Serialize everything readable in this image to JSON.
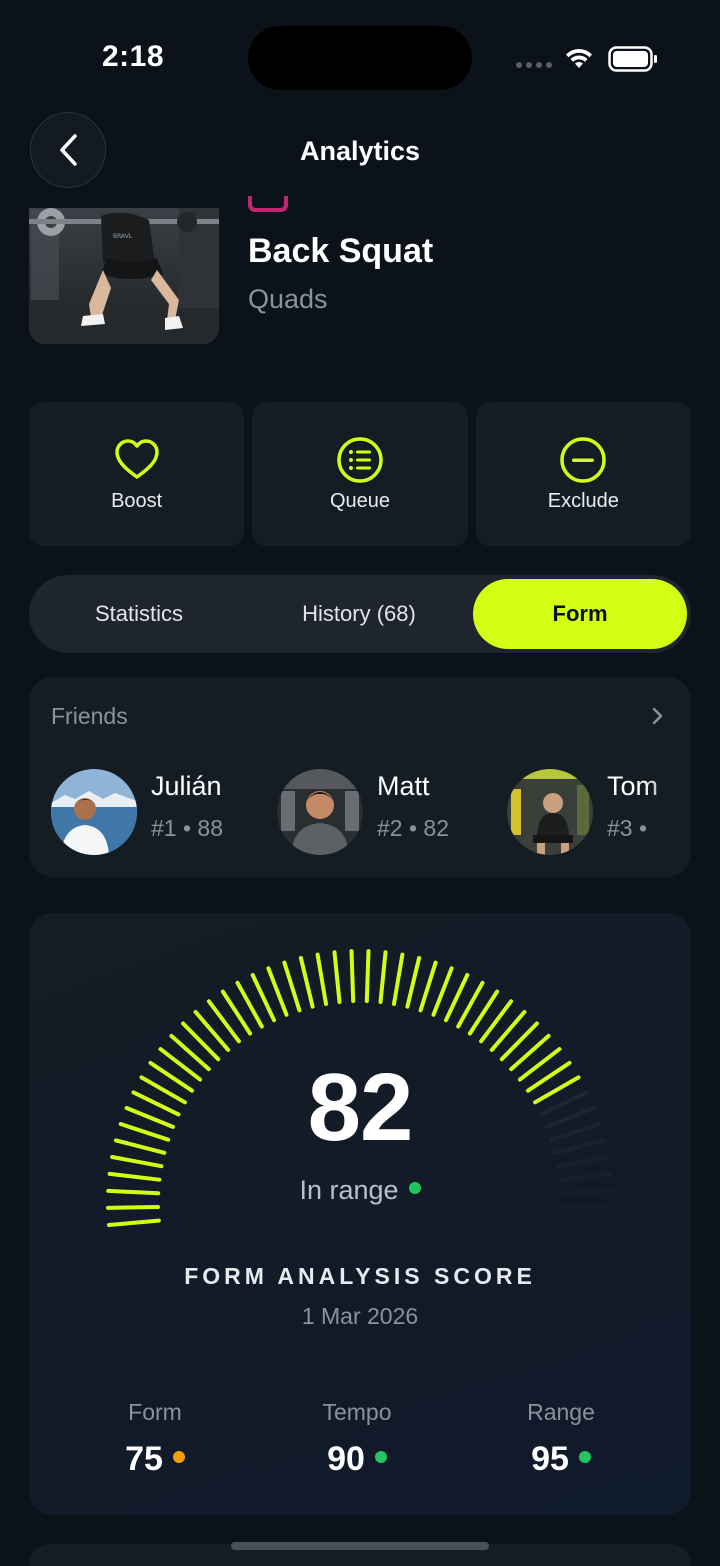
{
  "status_bar": {
    "time": "2:18"
  },
  "nav": {
    "title": "Analytics"
  },
  "exercise": {
    "name": "Back Squat",
    "muscle": "Quads"
  },
  "actions": [
    {
      "label": "Boost",
      "icon": "heart-icon"
    },
    {
      "label": "Queue",
      "icon": "list-icon"
    },
    {
      "label": "Exclude",
      "icon": "minus-circle-icon"
    }
  ],
  "tabs": [
    {
      "label": "Statistics",
      "active": false
    },
    {
      "label": "History (68)",
      "active": false
    },
    {
      "label": "Form",
      "active": true
    }
  ],
  "friends": {
    "title": "Friends",
    "items": [
      {
        "name": "Julián",
        "rank": "#1 • 88"
      },
      {
        "name": "Matt",
        "rank": "#2 • 82"
      },
      {
        "name": "Tom",
        "rank": "#3 •"
      }
    ]
  },
  "score": {
    "value": "82",
    "status": "In range",
    "label": "FORM ANALYSIS SCORE",
    "date": "1 Mar 2026",
    "fraction": 0.82,
    "metrics": [
      {
        "label": "Form",
        "value": "75",
        "status_color": "#f59e0b"
      },
      {
        "label": "Tempo",
        "value": "90",
        "status_color": "#22c55e"
      },
      {
        "label": "Range",
        "value": "95",
        "status_color": "#22c55e"
      }
    ]
  },
  "colors": {
    "accent": "#d4ff14",
    "background": "#0c1219",
    "card": "#141c24"
  }
}
